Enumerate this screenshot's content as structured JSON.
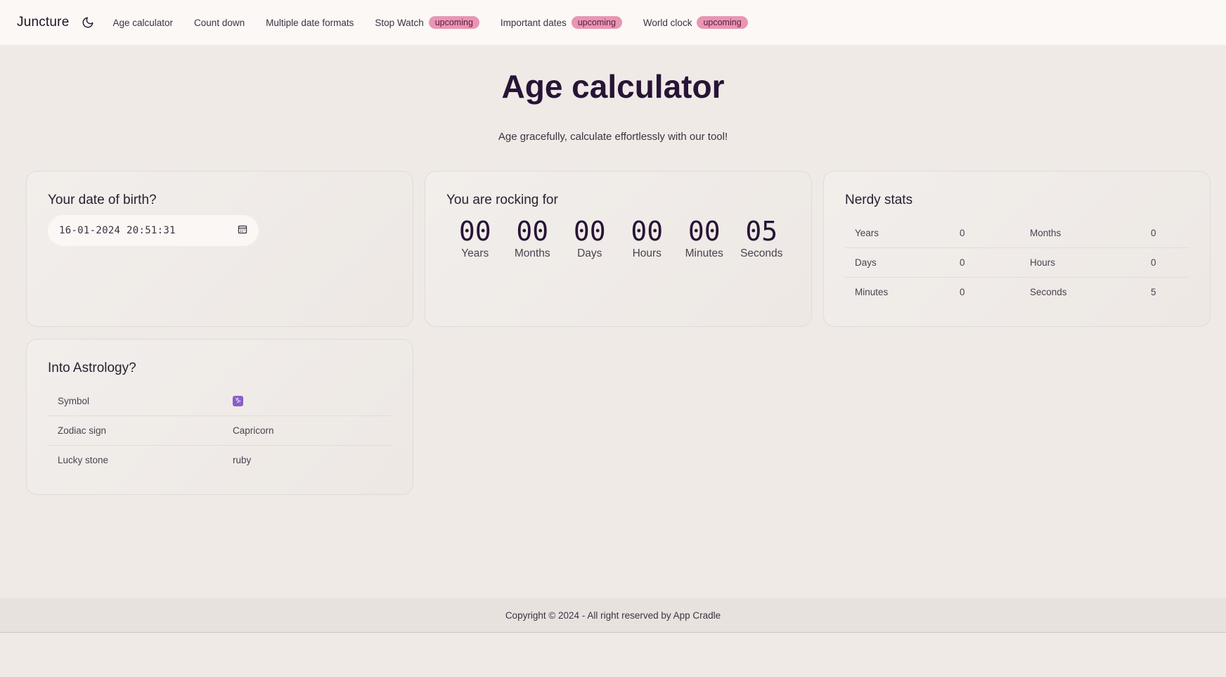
{
  "nav": {
    "brand": "Juncture",
    "items": [
      {
        "label": "Age calculator",
        "badge": ""
      },
      {
        "label": "Count down",
        "badge": ""
      },
      {
        "label": "Multiple date formats",
        "badge": ""
      },
      {
        "label": "Stop Watch",
        "badge": "upcoming"
      },
      {
        "label": "Important dates",
        "badge": "upcoming"
      },
      {
        "label": "World clock",
        "badge": "upcoming"
      }
    ]
  },
  "page": {
    "title": "Age calculator",
    "subtitle": "Age gracefully, calculate effortlessly with our tool!"
  },
  "dob_card": {
    "title": "Your date of birth?",
    "value": "16-01-2024 20:51:31"
  },
  "countdown_card": {
    "title": "You are rocking for",
    "units": [
      {
        "value": "00",
        "label": "Years"
      },
      {
        "value": "00",
        "label": "Months"
      },
      {
        "value": "00",
        "label": "Days"
      },
      {
        "value": "00",
        "label": "Hours"
      },
      {
        "value": "00",
        "label": "Minutes"
      },
      {
        "value": "05",
        "label": "Seconds"
      }
    ]
  },
  "stats_card": {
    "title": "Nerdy stats",
    "rows": [
      {
        "l1": "Years",
        "v1": "0",
        "l2": "Months",
        "v2": "0"
      },
      {
        "l1": "Days",
        "v1": "0",
        "l2": "Hours",
        "v2": "0"
      },
      {
        "l1": "Minutes",
        "v1": "0",
        "l2": "Seconds",
        "v2": "5"
      }
    ]
  },
  "astro_card": {
    "title": "Into Astrology?",
    "rows": [
      {
        "label": "Symbol",
        "value": "♑"
      },
      {
        "label": "Zodiac sign",
        "value": "Capricorn"
      },
      {
        "label": "Lucky stone",
        "value": "ruby"
      }
    ]
  },
  "footer": {
    "text": "Copyright © 2024 - All right reserved by App Cradle"
  },
  "colors": {
    "accent": "#271436",
    "badge": "#e995b3",
    "symbol": "#8a5fc9"
  },
  "icons": {
    "theme_toggle": "moon-icon",
    "date_picker": "calendar-icon"
  }
}
